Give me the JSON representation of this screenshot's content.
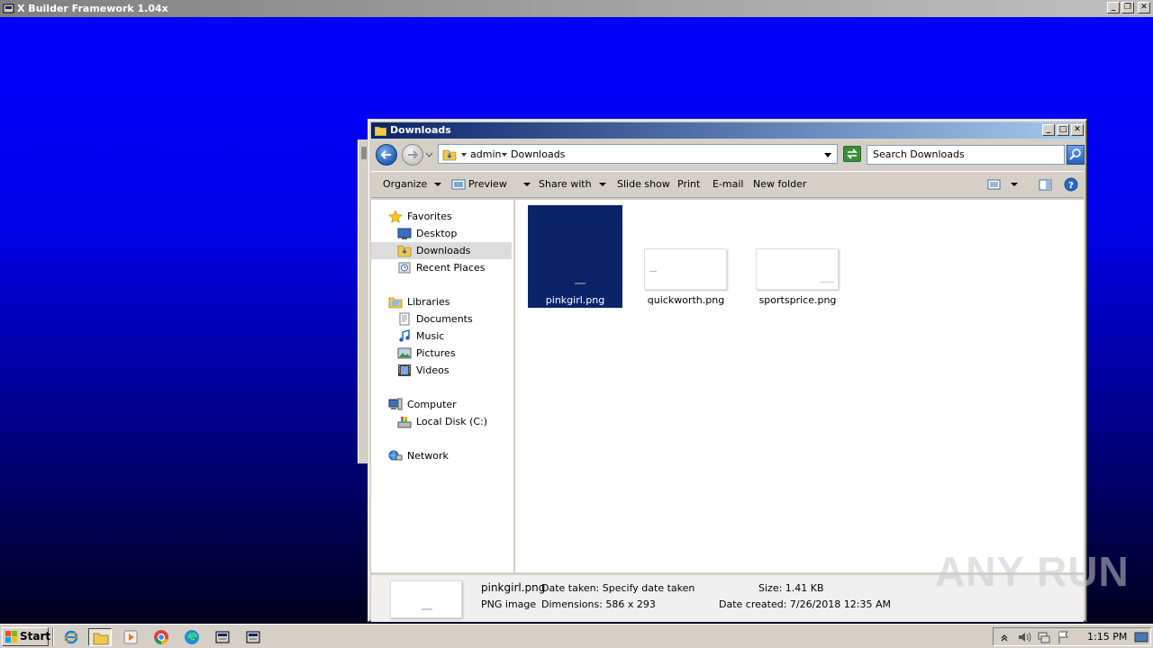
{
  "app": {
    "title": "X Builder Framework 1.04x"
  },
  "window": {
    "title": "Downloads"
  },
  "address": {
    "crumbs": [
      "admin",
      "Downloads"
    ],
    "search_placeholder": "Search Downloads"
  },
  "toolbar": {
    "organize": "Organize",
    "preview": "Preview",
    "share_with": "Share with",
    "slide_show": "Slide show",
    "print": "Print",
    "email": "E-mail",
    "new_folder": "New folder"
  },
  "nav": {
    "favorites": "Favorites",
    "desktop": "Desktop",
    "downloads": "Downloads",
    "recent_places": "Recent Places",
    "libraries": "Libraries",
    "documents": "Documents",
    "music": "Music",
    "pictures": "Pictures",
    "videos": "Videos",
    "computer": "Computer",
    "local_disk": "Local Disk (C:)",
    "network": "Network"
  },
  "files": [
    {
      "name": "pinkgirl.png",
      "selected": true
    },
    {
      "name": "quickworth.png",
      "selected": false
    },
    {
      "name": "sportsprice.png",
      "selected": false
    }
  ],
  "details": {
    "file_name": "pinkgirl.png",
    "file_type": "PNG image",
    "date_taken": "Date taken: Specify date taken",
    "dimensions": "Dimensions: 586 x 293",
    "size": "Size: 1.41 KB",
    "date_created": "Date created: 7/26/2018 12:35 AM"
  },
  "taskbar": {
    "start": "Start",
    "clock": "1:15 PM"
  },
  "watermark": "ANY RUN",
  "colors": {
    "desktop_top": "#0000ff",
    "desktop_bottom": "#000010",
    "title_active": "#0a246a",
    "selection": "#0a246a"
  }
}
